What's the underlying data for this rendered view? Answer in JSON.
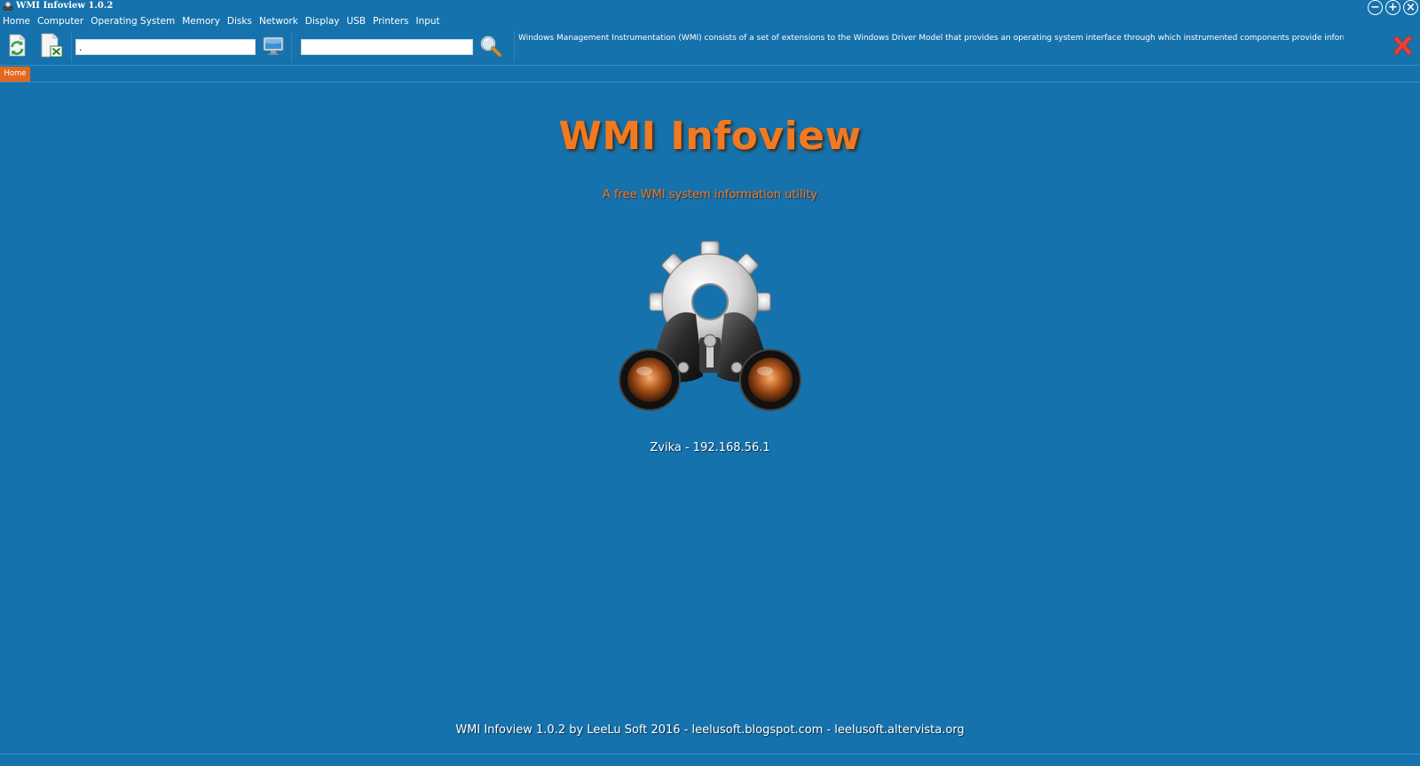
{
  "window": {
    "title": "WMI Infoview 1.0.2",
    "controls": {
      "minimize": "−",
      "maximize": "+",
      "close": "×"
    }
  },
  "menu": {
    "items": [
      "Home",
      "Computer",
      "Operating System",
      "Memory",
      "Disks",
      "Network",
      "Display",
      "USB",
      "Printers",
      "Input"
    ]
  },
  "toolbar": {
    "icons": [
      "refresh-icon",
      "export-excel-icon",
      "monitor-icon",
      "magnifier-icon",
      "close-x-icon"
    ],
    "computer_input_value": ".",
    "search_input_value": "",
    "description": "Windows Management Instrumentation (WMI) consists of a set of extensions to the Windows Driver Model that provides an operating system interface through which instrumented components provide information and notification"
  },
  "tabs": [
    "Home"
  ],
  "main": {
    "title": "WMI Infoview",
    "subtitle": "A free WMI system information utility",
    "host": "Zvika - 192.168.56.1",
    "logo_icon": "gear-binoculars-icon",
    "footer": "WMI Infoview 1.0.2 by LeeLu Soft 2016 - leelusoft.blogspot.com - leelusoft.altervista.org"
  },
  "colors": {
    "background": "#1572ac",
    "accent_orange": "#f07a22",
    "tab_orange": "#e3691c",
    "close_red": "#e8423b"
  }
}
